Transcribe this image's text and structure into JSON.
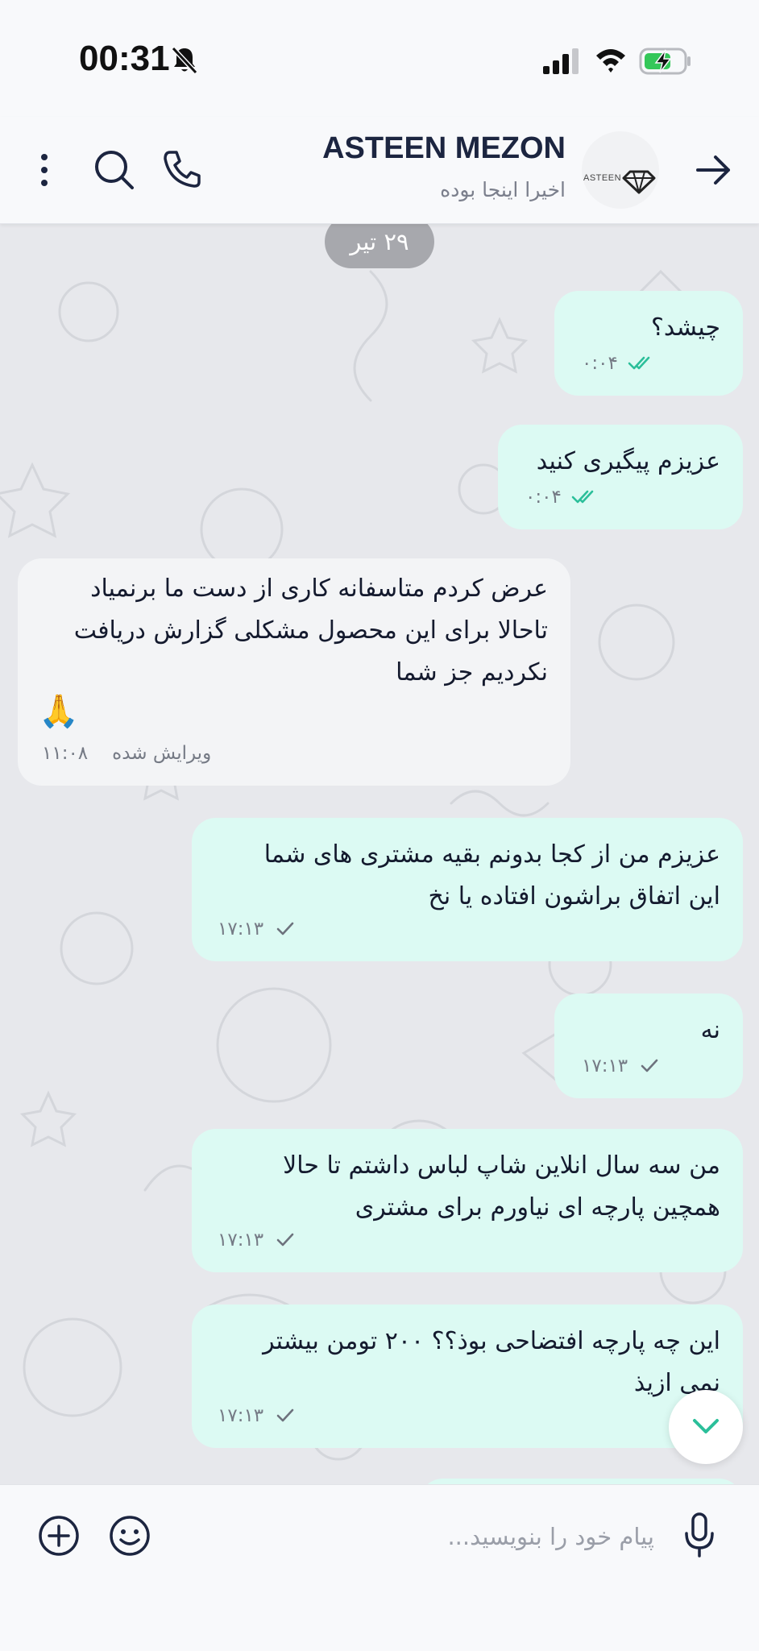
{
  "status_bar": {
    "time": "00:31"
  },
  "header": {
    "title": "ASTEEN MEZON",
    "subtitle": "اخیرا اینجا بوده",
    "avatar_text": "ASTEEN"
  },
  "chat": {
    "date_label": "۲۹ تیر",
    "messages": [
      {
        "direction": "out",
        "text": "چیشد؟",
        "time": "۰:۰۴",
        "status": "read"
      },
      {
        "direction": "out",
        "text": "عزیزم پیگیری کنید",
        "time": "۰:۰۴",
        "status": "read"
      },
      {
        "direction": "in",
        "lines": [
          "عرض کردم متاسفانه کاری از دست ما برنمیاد",
          "تاحالا برای این محصول مشکلی گزارش دریافت",
          "نکردیم جز شما"
        ],
        "emoji": "🙏",
        "edited_label": "ویرایش شده",
        "time": "۱۱:۰۸"
      },
      {
        "direction": "out",
        "lines": [
          "عزیزم من از کجا بدونم بقیه مشتری های شما",
          "این اتفاق براشون افتاده یا نخ"
        ],
        "time": "۱۷:۱۳",
        "status": "sent"
      },
      {
        "direction": "out",
        "text": "نه",
        "time": "۱۷:۱۳",
        "status": "sent"
      },
      {
        "direction": "out",
        "lines": [
          "من سه سال انلاین شاپ لباس داشتم تا حالا",
          "همچین پارچه ای نیاورم برای مشتری"
        ],
        "time": "۱۷:۱۳",
        "status": "sent"
      },
      {
        "direction": "out",
        "lines": [
          "این چه پارچه افتضاحی بوذ؟؟ ۲۰۰ تومن بیشتر",
          "نمی ازیذ"
        ],
        "time": "۱۷:۱۳",
        "status": "sent"
      }
    ]
  },
  "input": {
    "placeholder": "پیام خود را بنویسید..."
  },
  "colors": {
    "outgoing_bubble": "#dcfaf3",
    "incoming_bubble": "#f3f4f6",
    "read_check": "#2bbf9a",
    "chat_bg": "#e7e8ec"
  },
  "icons": [
    "bell-off-icon",
    "signal-icon",
    "wifi-icon",
    "battery-charging-icon",
    "back-arrow-icon",
    "menu-icon",
    "search-icon",
    "phone-icon",
    "double-check-icon",
    "single-check-icon",
    "chevron-down-icon",
    "add-icon",
    "emoji-icon",
    "microphone-icon"
  ]
}
